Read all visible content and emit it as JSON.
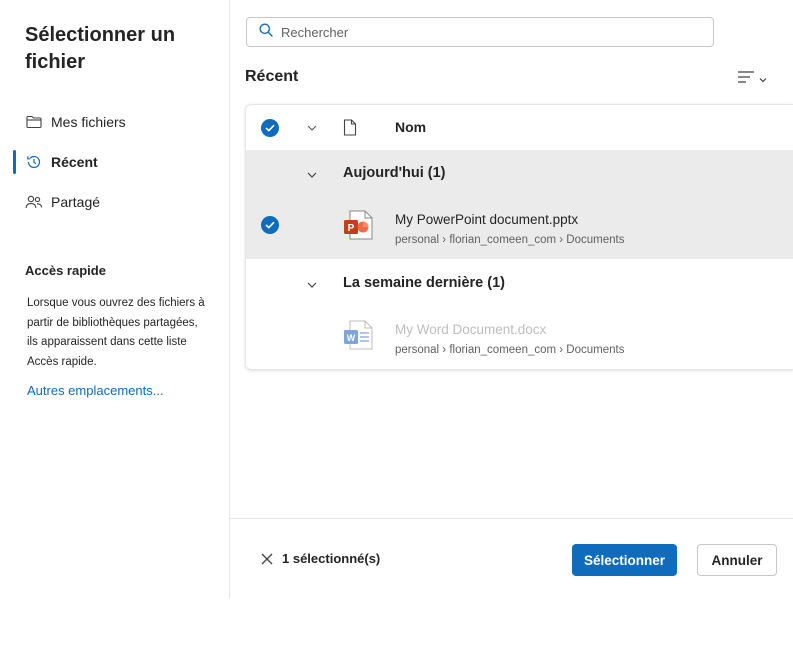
{
  "dialog": {
    "title": "Sélectionner un fichier"
  },
  "sidebar": {
    "items": [
      {
        "label": "Mes fichiers",
        "icon": "folder-icon",
        "active": false
      },
      {
        "label": "Récent",
        "icon": "clock-icon",
        "active": true
      },
      {
        "label": "Partagé",
        "icon": "people-icon",
        "active": false
      }
    ],
    "quick_access": {
      "title": "Accès rapide",
      "description": "Lorsque vous ouvrez des fichiers à partir de bibliothèques partagées, ils apparaissent dans cette liste Accès rapide.",
      "link": "Autres emplacements..."
    }
  },
  "search": {
    "placeholder": "Rechercher"
  },
  "main": {
    "section_title": "Récent",
    "column_header": "Nom",
    "groups": [
      {
        "label": "Aujourd'hui (1)",
        "files": [
          {
            "name": "My PowerPoint document.pptx",
            "path": "personal › florian_comeen_com › Documents",
            "type": "powerpoint",
            "selected": true
          }
        ]
      },
      {
        "label": "La semaine dernière (1)",
        "files": [
          {
            "name": "My Word Document.docx",
            "path": "personal › florian_comeen_com › Documents",
            "type": "word",
            "selected": false
          }
        ]
      }
    ]
  },
  "footer": {
    "selection_count": "1 sélectionné(s)",
    "select_label": "Sélectionner",
    "cancel_label": "Annuler"
  },
  "colors": {
    "accent": "#0f6cbd",
    "powerpoint": "#c43e1c",
    "word": "#185abd",
    "selected_row": "#ebebeb"
  }
}
